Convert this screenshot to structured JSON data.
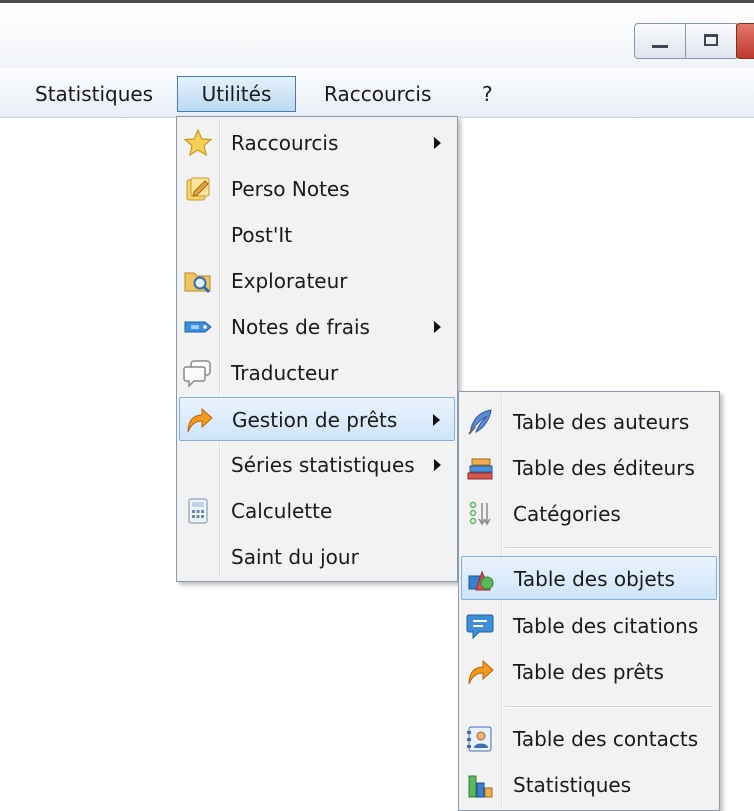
{
  "menubar": {
    "items": [
      {
        "label": "Statistiques"
      },
      {
        "label": "Utilités"
      },
      {
        "label": "Raccourcis"
      },
      {
        "label": "?"
      }
    ]
  },
  "utilities_menu": {
    "items": [
      {
        "label": "Raccourcis",
        "icon": "star-icon",
        "submenu": true
      },
      {
        "label": "Perso Notes",
        "icon": "notes-icon",
        "submenu": false
      },
      {
        "label": "Post'It",
        "icon": "",
        "submenu": false
      },
      {
        "label": "Explorateur",
        "icon": "folder-search-icon",
        "submenu": false
      },
      {
        "label": "Notes de frais",
        "icon": "expense-tag-icon",
        "submenu": true
      },
      {
        "label": "Traducteur",
        "icon": "speech-bubbles-icon",
        "submenu": false
      },
      {
        "label": "Gestion de prêts",
        "icon": "loan-arrow-icon",
        "submenu": true,
        "highlighted": true
      },
      {
        "label": "Séries statistiques",
        "icon": "",
        "submenu": true
      },
      {
        "label": "Calculette",
        "icon": "calculator-icon",
        "submenu": false
      },
      {
        "label": "Saint du jour",
        "icon": "",
        "submenu": false
      }
    ]
  },
  "loans_submenu": {
    "items": [
      {
        "label": "Table des auteurs",
        "icon": "quill-icon"
      },
      {
        "label": "Table des éditeurs",
        "icon": "books-icon"
      },
      {
        "label": "Catégories",
        "icon": "sort-categories-icon"
      },
      {
        "label": "Table des objets",
        "icon": "objects-icon",
        "highlighted": true
      },
      {
        "label": "Table des citations",
        "icon": "quote-bubble-icon"
      },
      {
        "label": "Table des prêts",
        "icon": "loan-arrow-icon"
      },
      {
        "label": "Table des contacts",
        "icon": "contacts-icon"
      },
      {
        "label": "Statistiques",
        "icon": "bar-chart-icon"
      }
    ]
  }
}
